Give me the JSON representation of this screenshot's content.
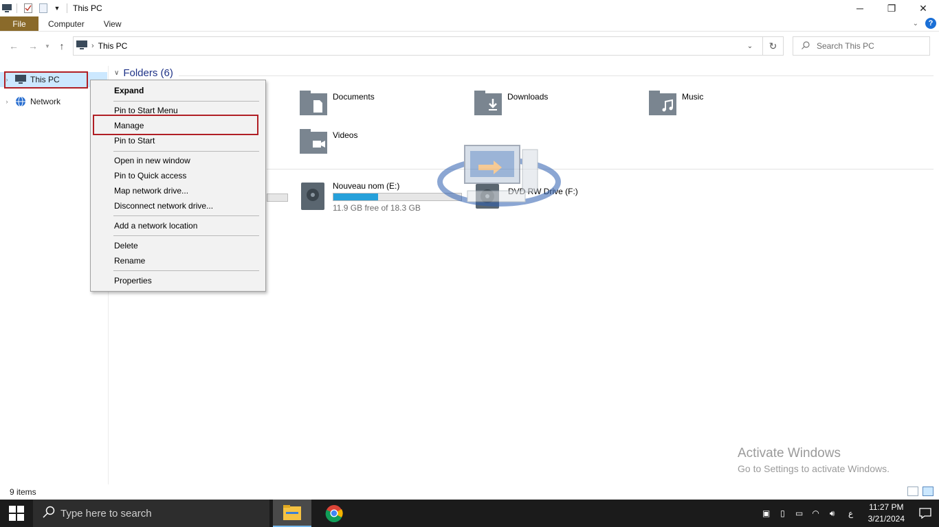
{
  "window": {
    "title": "This PC",
    "minimize": "─",
    "maximize": "❐",
    "close": "✕"
  },
  "ribbon": {
    "tabs": [
      "File",
      "Computer",
      "View"
    ]
  },
  "address": {
    "path": "This PC",
    "search_placeholder": "Search This PC"
  },
  "navpane": {
    "items": [
      {
        "label": "This PC",
        "icon": "monitor-icon",
        "selected": true
      },
      {
        "label": "Network",
        "icon": "network-icon",
        "selected": false
      }
    ]
  },
  "content": {
    "folders_header": "Folders (6)",
    "folders": [
      {
        "label": "Documents",
        "icon": "documents-folder-icon"
      },
      {
        "label": "Downloads",
        "icon": "downloads-folder-icon"
      },
      {
        "label": "Music",
        "icon": "music-folder-icon"
      },
      {
        "label": "Videos",
        "icon": "videos-folder-icon"
      }
    ],
    "drives": [
      {
        "name": "Nouveau nom (E:)",
        "free_text": "11.9 GB free of 18.3 GB",
        "used_fraction": 0.35
      },
      {
        "name": "DVD RW Drive (F:)"
      }
    ]
  },
  "context_menu": {
    "items": [
      {
        "label": "Expand",
        "bold": true
      },
      {
        "label": "Pin to Start Menu"
      },
      {
        "label": "Manage",
        "highlighted": true
      },
      {
        "label": "Pin to Start"
      },
      {
        "label": "Open in new window"
      },
      {
        "label": "Pin to Quick access"
      },
      {
        "label": "Map network drive..."
      },
      {
        "label": "Disconnect network drive..."
      },
      {
        "label": "Add a network location"
      },
      {
        "label": "Delete"
      },
      {
        "label": "Rename"
      },
      {
        "label": "Properties"
      }
    ]
  },
  "status": {
    "item_count": "9 items"
  },
  "activation": {
    "line1": "Activate Windows",
    "line2": "Go to Settings to activate Windows."
  },
  "taskbar": {
    "search_placeholder": "Type here to search",
    "language": "ع",
    "time": "11:27 PM",
    "date": "3/21/2024"
  },
  "colors": {
    "file_tab": "#8a6a2a",
    "selection": "#cce8ff",
    "highlight_box": "#b01e24",
    "drive_bar": "#26a0da",
    "group_header": "#1e3287"
  }
}
